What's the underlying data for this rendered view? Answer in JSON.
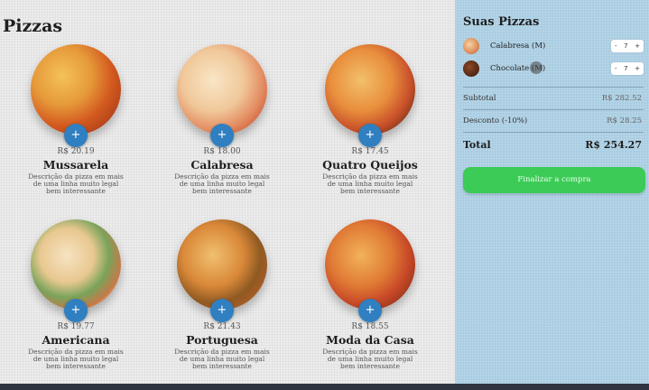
{
  "main": {
    "title": "Pizzas",
    "add_label": "+",
    "pizzas": [
      {
        "name": "Mussarela",
        "price": "R$ 20.19",
        "description": "Descrição da pizza em mais de uma linha muito legal bem interessante"
      },
      {
        "name": "Calabresa",
        "price": "R$ 18.00",
        "description": "Descrição da pizza em mais de uma linha muito legal bem interessante"
      },
      {
        "name": "Quatro Queijos",
        "price": "R$ 17.45",
        "description": "Descrição da pizza em mais de uma linha muito legal bem interessante"
      },
      {
        "name": "Americana",
        "price": "R$ 19.77",
        "description": "Descrição da pizza em mais de uma linha muito legal bem interessante"
      },
      {
        "name": "Portuguesa",
        "price": "R$ 21.43",
        "description": "Descrição da pizza em mais de uma linha muito legal bem interessante"
      },
      {
        "name": "Moda da Casa",
        "price": "R$ 18.55",
        "description": "Descrição da pizza em mais de uma linha muito legal bem interessante"
      }
    ]
  },
  "sidebar": {
    "title": "Suas Pizzas",
    "items": [
      {
        "label": "Calabresa (M)",
        "qty": "7",
        "minus": "-",
        "plus": "+"
      },
      {
        "label": "Chocolate (M)",
        "qty": "7",
        "minus": "-",
        "plus": "+"
      }
    ],
    "subtotal_label": "Subtotal",
    "subtotal_value": "R$ 282.52",
    "discount_label": "Desconto (-10%)",
    "discount_value": "R$ 28.25",
    "total_label": "Total",
    "total_value": "R$ 254.27",
    "checkout_label": "Finalizar a compra"
  },
  "colors": {
    "accent_blue": "#2f7fc1",
    "sidebar_bg": "#a9cde2",
    "checkout_green": "#3ccb57"
  },
  "icons": [
    "plus-icon",
    "cursor-icon"
  ]
}
